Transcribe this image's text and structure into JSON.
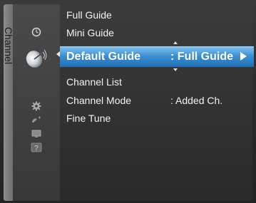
{
  "sidebar": {
    "title": "Channel",
    "icons": [
      "clock-icon",
      "satellite-dish-icon",
      "gear-icon",
      "antenna-icon",
      "tv-icon",
      "help-icon"
    ]
  },
  "menu": {
    "items": [
      {
        "label": "Full Guide",
        "value": ""
      },
      {
        "label": "Mini Guide",
        "value": ""
      },
      {
        "label": "Default Guide",
        "value": ": Full Guide",
        "selected": true
      },
      {
        "label": "Channel List",
        "value": ""
      },
      {
        "label": "Channel Mode",
        "value": ": Added Ch."
      },
      {
        "label": "Fine Tune",
        "value": ""
      }
    ]
  },
  "colors": {
    "highlight": "#3d8fcf",
    "text": "#f2f2f2"
  }
}
